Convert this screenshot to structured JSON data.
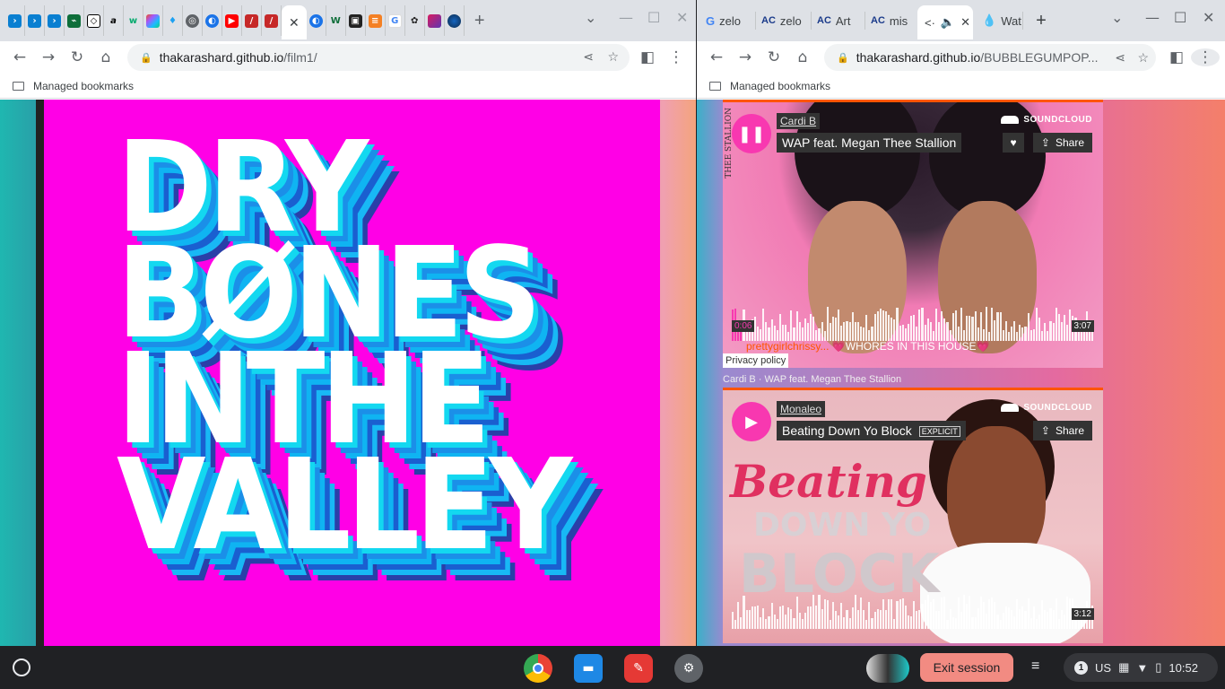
{
  "left_window": {
    "url_host": "thakarashard.github.io",
    "url_path": "/film1/",
    "bookmarks_label": "Managed bookmarks",
    "poster_lines": [
      "DRY",
      "BØNES",
      "INTHE",
      "VALLEY"
    ]
  },
  "right_window": {
    "tabs": [
      {
        "label": "zelo"
      },
      {
        "label": "zelo"
      },
      {
        "label": "Art"
      },
      {
        "label": "mis"
      },
      {
        "label": "<·"
      },
      {
        "label": "Wat"
      }
    ],
    "url_host": "thakarashard.github.io",
    "url_path": "/BUBBLEGUMPOP...",
    "bookmarks_label": "Managed bookmarks",
    "player1": {
      "artist": "Cardi B",
      "title": "WAP feat. Megan Thee Stallion",
      "brand": "SOUNDCLOUD",
      "share": "Share",
      "elapsed": "0:06",
      "duration": "3:07",
      "comment_user": "prettygirlchrissy...",
      "comment_text": "💗WHORES IN THIS HOUSE💗",
      "privacy": "Privacy policy",
      "attribution": "Cardi B · WAP feat. Megan Thee Stallion",
      "progress": 0.03,
      "side_text": "THEE STALLION"
    },
    "player2": {
      "artist": "Monaleo",
      "title": "Beating Down Yo Block",
      "explicit": "EXPLICIT",
      "brand": "SOUNDCLOUD",
      "share": "Share",
      "duration": "3:12",
      "art_line1": "Beating",
      "art_line2": "DOWN YO",
      "art_line3": "BLOCK"
    }
  },
  "shelf": {
    "exit_session": "Exit session",
    "keyboard": "US",
    "notifications": "1",
    "time": "10:52"
  }
}
